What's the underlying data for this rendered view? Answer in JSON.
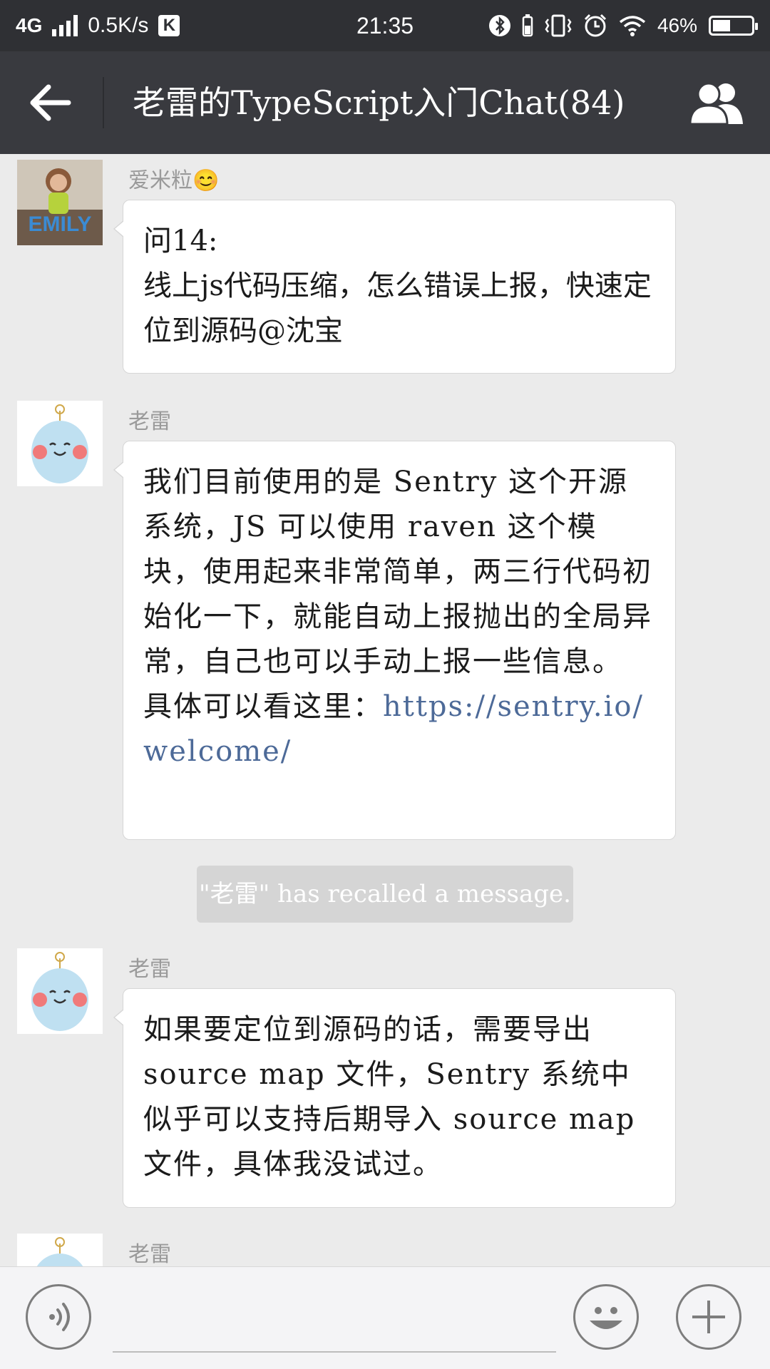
{
  "status_bar": {
    "network": "4G",
    "speed": "0.5K/s",
    "app_badge": "K",
    "time": "21:35",
    "battery_percent": "46%",
    "battery_level": 0.46
  },
  "nav": {
    "title": "老雷的TypeScript入门Chat(84)"
  },
  "messages": [
    {
      "sender": "爱米粒😊",
      "lines": [
        "问14:",
        "线上js代码压缩，怎么错误上报，快速定位到源码@沈宝"
      ]
    },
    {
      "sender": "老雷",
      "text": "我们目前使用的是 Sentry 这个开源系统，JS 可以使用 raven 这个模块，使用起来非常简单，两三行代码初始化一下，就能自动上报抛出的全局异常，自己也可以手动上报一些信息。",
      "link_prefix": "具体可以看这里：",
      "link": "https://sentry.io/welcome/"
    },
    {
      "sender": "老雷",
      "text": "如果要定位到源码的话，需要导出 source map 文件，Sentry 系统中似乎可以支持后期导入 source map 文件，具体我没试过。"
    },
    {
      "sender": "老雷"
    }
  ],
  "system_notice": "\"老雷\" has recalled a message.",
  "avatar_1_text": "EMILY"
}
